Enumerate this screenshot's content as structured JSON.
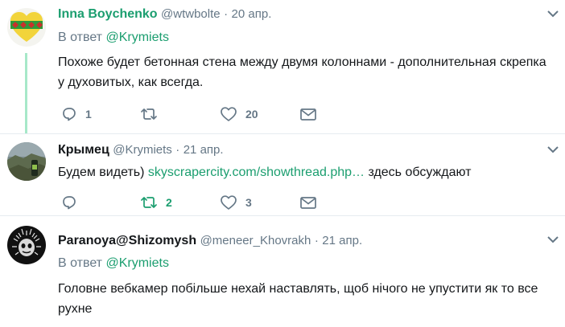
{
  "tweets": [
    {
      "name": "Inna Boychenko",
      "handle": "@wtwbolte",
      "separator": "·",
      "date": "20 апр.",
      "reply_prefix": "В ответ",
      "reply_handle": "@Krymiets",
      "text": "Похоже будет бетонная стена между двумя колоннами - дополнительная скрепка у духовитых, как всегда.",
      "counts": {
        "reply": "1",
        "retweet": "",
        "like": "20"
      }
    },
    {
      "name": "Крымец",
      "handle": "@Krymiets",
      "separator": "·",
      "date": "21 апр.",
      "text_before": "Будем видеть) ",
      "link": "skyscrapercity.com/showthread.php…",
      "text_after": " здесь обсуждают",
      "counts": {
        "reply": "",
        "retweet": "2",
        "like": "3"
      }
    },
    {
      "name": "Paranoya@Shizomysh",
      "handle": "@meneer_Khovrakh",
      "separator": "·",
      "date": "21 апр.",
      "reply_prefix": "В ответ",
      "reply_handle": "@Krymiets",
      "text": "Головне вебкамер побільше нехай наставлять, щоб нічого не упустити як то все рухне"
    }
  ],
  "colors": {
    "accent": "#1b9e6f",
    "muted": "#657786",
    "thread": "#a7e8c9"
  },
  "icons": [
    "reply-icon",
    "retweet-icon",
    "heart-icon",
    "mail-icon",
    "chevron-down-icon"
  ]
}
